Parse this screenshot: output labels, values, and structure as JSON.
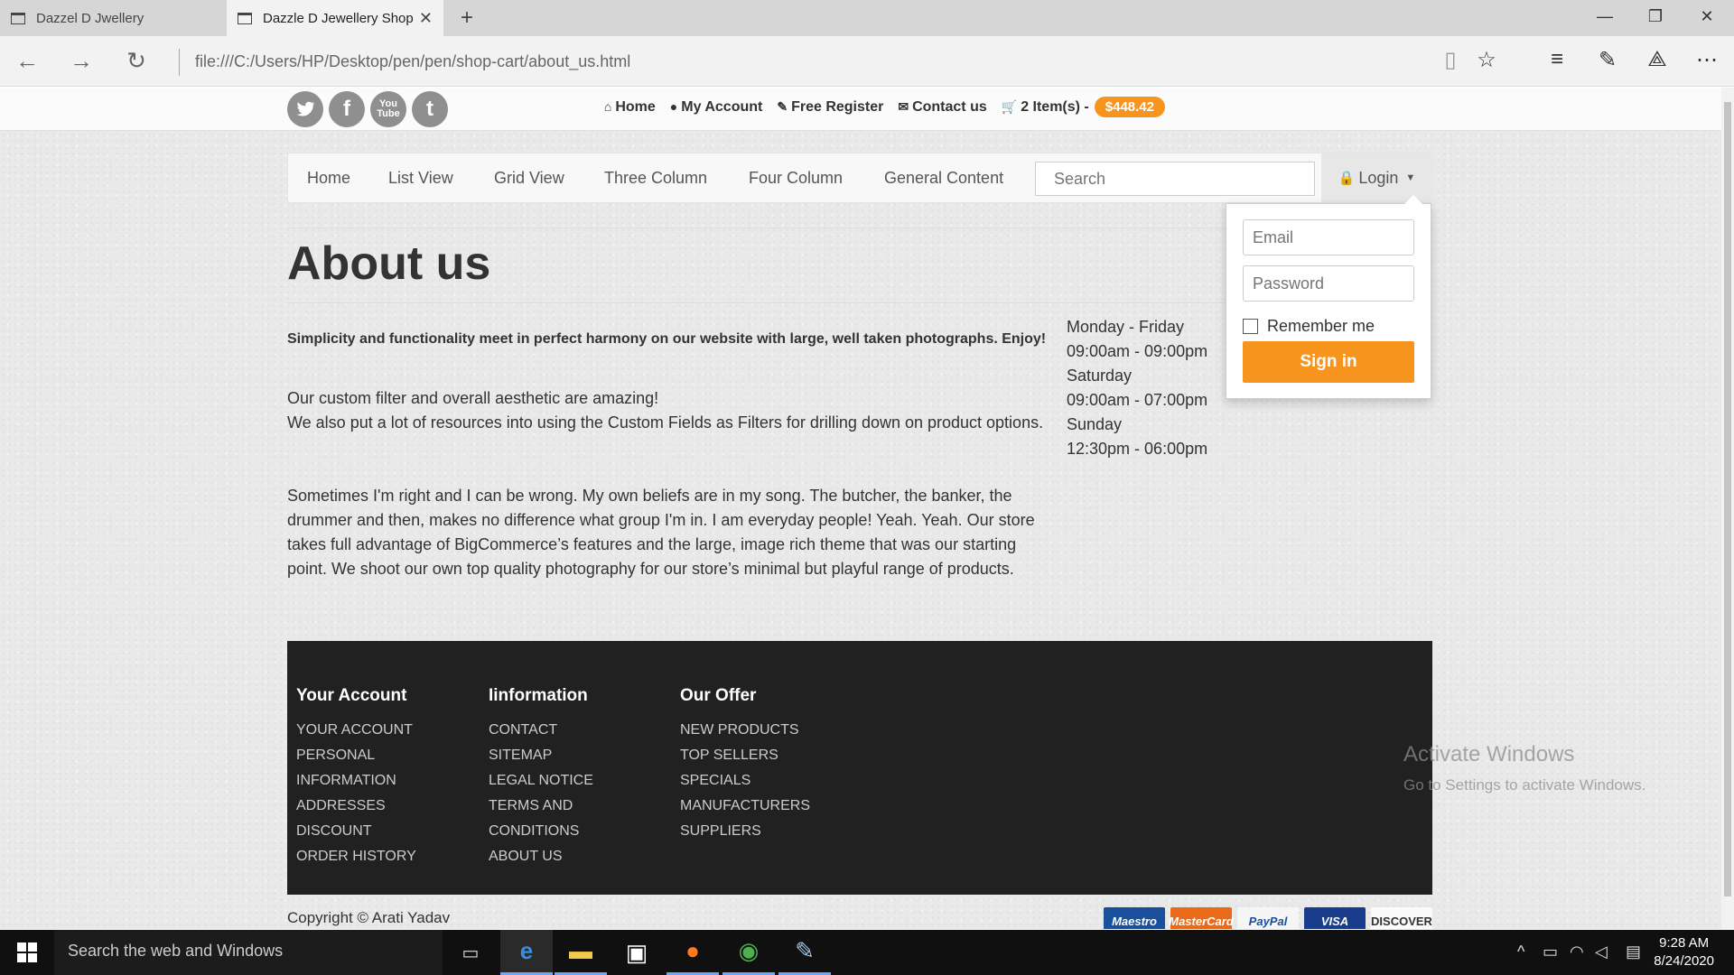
{
  "browser": {
    "tabs": [
      {
        "label": "Dazzel D Jwellery"
      },
      {
        "label": "Dazzle D Jewellery Shop"
      }
    ],
    "url": "file:///C:/Users/HP/Desktop/pen/pen/shop-cart/about_us.html"
  },
  "topbar": {
    "social": [
      "twitter-icon",
      "facebook-icon",
      "youtube-icon",
      "tumblr-icon"
    ],
    "links": {
      "home": "Home",
      "account": "My Account",
      "register": "Free Register",
      "contact": "Contact us",
      "cart": "2 Item(s) -",
      "cart_total": "$448.42"
    }
  },
  "nav": {
    "items": [
      "Home",
      "List View",
      "Grid View",
      "Three Column",
      "Four Column",
      "General Content"
    ],
    "search_placeholder": "Search",
    "login_label": "Login"
  },
  "login_dropdown": {
    "email_placeholder": "Email",
    "password_placeholder": "Password",
    "remember_label": "Remember me",
    "sign_in_label": "Sign in"
  },
  "main": {
    "title": "About us",
    "intro": "Simplicity and functionality meet in perfect harmony on our website with large, well taken photographs. Enjoy!",
    "para1_line1": "Our custom filter and overall aesthetic are amazing!",
    "para1_line2": "We also put a lot of resources into using the Custom Fields as Filters for drilling down on product options.",
    "para2": "Sometimes I'm right and I can be wrong. My own beliefs are in my song. The butcher, the banker, the drummer and then, makes no difference what group I'm in. I am everyday people! Yeah. Yeah. Our store takes full advantage of BigCommerce’s features and the large, image rich theme that was our starting point. We shoot our own top quality photography for our store’s minimal but playful range of products.",
    "hours": [
      "Monday - Friday",
      "09:00am - 09:00pm",
      "Saturday",
      "09:00am - 07:00pm",
      "Sunday",
      "12:30pm - 06:00pm"
    ]
  },
  "footer": {
    "columns": [
      {
        "heading": "Your Account",
        "links": [
          "YOUR ACCOUNT",
          "PERSONAL INFORMATION",
          "ADDRESSES",
          "DISCOUNT",
          "ORDER HISTORY"
        ]
      },
      {
        "heading": "Iinformation",
        "links": [
          "CONTACT",
          "SITEMAP",
          "LEGAL NOTICE",
          "TERMS AND CONDITIONS",
          "ABOUT US"
        ]
      },
      {
        "heading": "Our Offer",
        "links": [
          "NEW PRODUCTS",
          "TOP SELLERS",
          "SPECIALS",
          "MANUFACTURERS",
          "SUPPLIERS"
        ]
      }
    ],
    "copyright": "Copyright © Arati Yadav",
    "payments": [
      "Maestro",
      "MasterCard",
      "PayPal",
      "VISA",
      "DISCOVER"
    ]
  },
  "watermark": {
    "line1": "Activate Windows",
    "line2": "Go to Settings to activate Windows."
  },
  "taskbar": {
    "search_placeholder": "Search the web and Windows",
    "time": "9:28 AM",
    "date": "8/24/2020"
  },
  "colors": {
    "accent": "#f7941d",
    "footer_bg": "#212121",
    "taskbar_bg": "#101010"
  }
}
